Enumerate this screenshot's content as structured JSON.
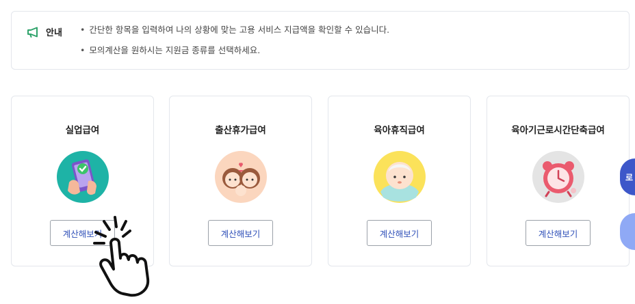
{
  "notice": {
    "title": "안내",
    "icon": "megaphone-icon",
    "icon_color": "#2fa36b",
    "lines": [
      "간단한 항목을 입력하여 나의 상황에 맞는 고용 서비스 지급액을 확인할 수 있습니다.",
      "모의계산을 원하시는 지원금 종류를 선택하세요."
    ]
  },
  "cards": [
    {
      "title": "실업급여",
      "button": "계산해보기",
      "icon": "phone-check-icon"
    },
    {
      "title": "출산휴가급여",
      "button": "계산해보기",
      "icon": "mother-baby-icon"
    },
    {
      "title": "육아휴직급여",
      "button": "계산해보기",
      "icon": "baby-icon"
    },
    {
      "title": "육아기근로시간단축급여",
      "button": "계산해보기",
      "icon": "alarm-clock-icon"
    }
  ],
  "floating": {
    "top_label": "로",
    "top_color": "#3d57c9",
    "bottom_color": "#8fa9f5"
  },
  "button_text_color": "#2e4fb8"
}
